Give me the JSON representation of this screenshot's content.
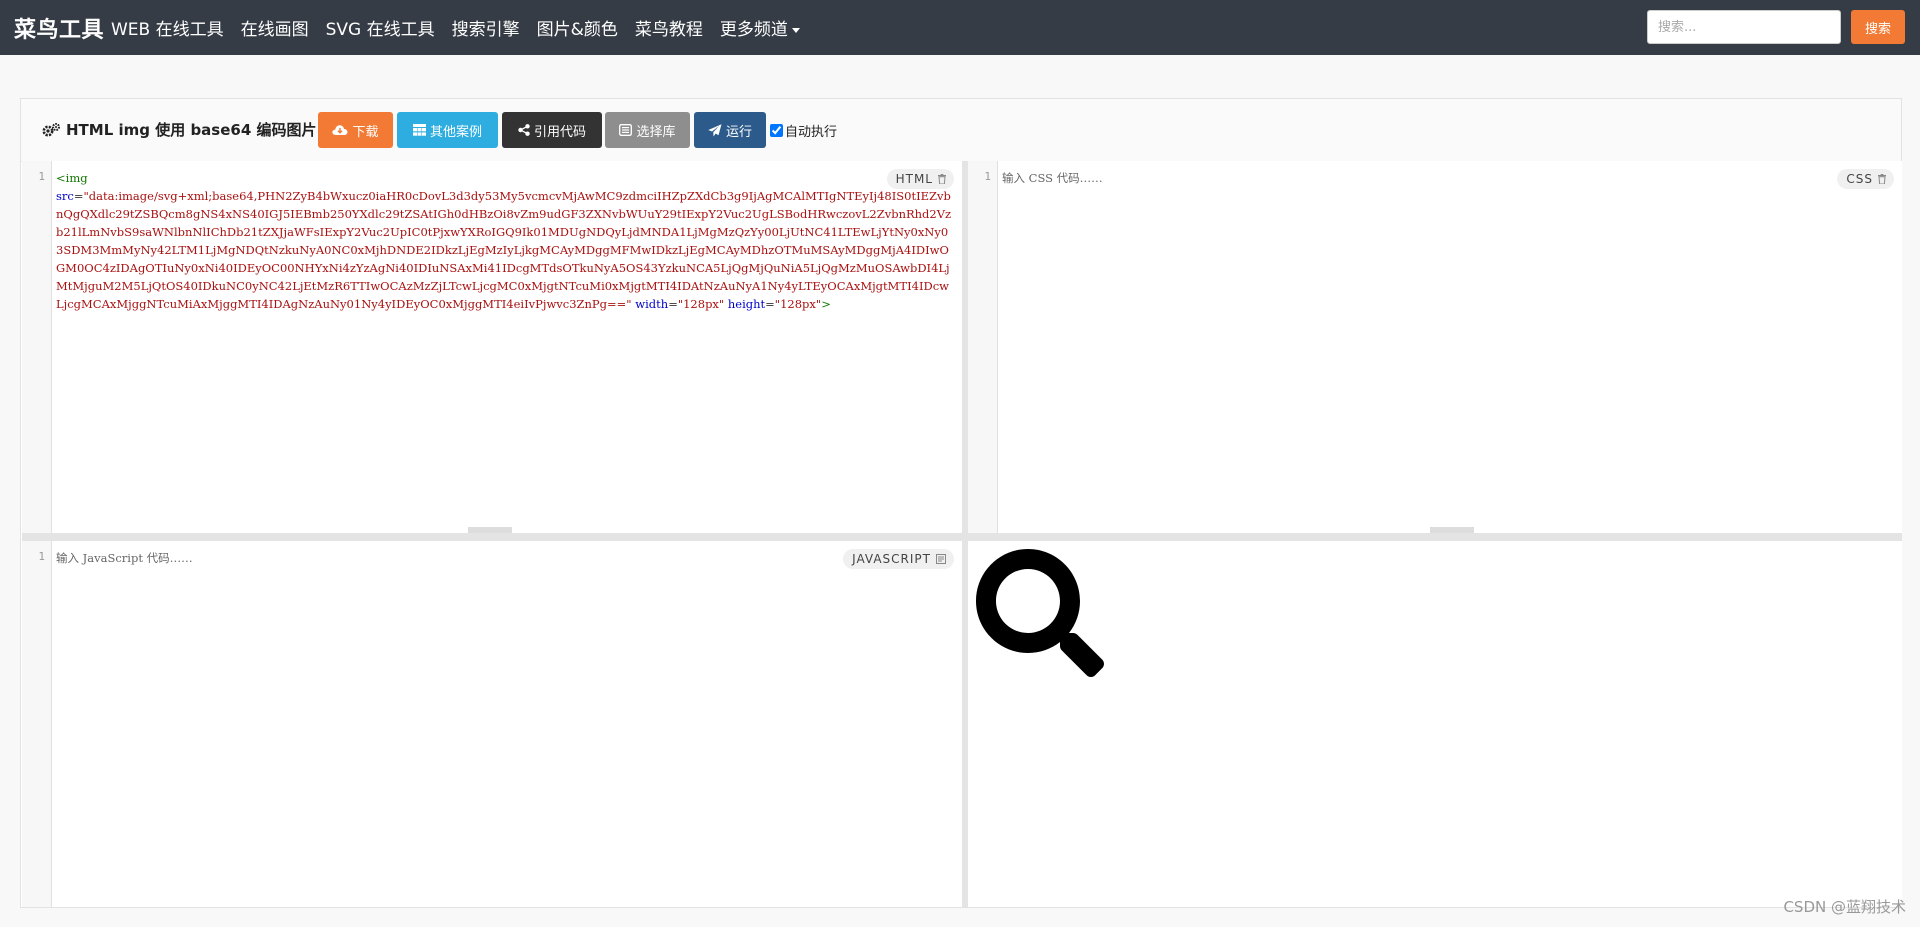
{
  "navbar": {
    "brand": "菜鸟工具",
    "items": [
      "WEB 在线工具",
      "在线画图",
      "SVG 在线工具",
      "搜索引擎",
      "图片&颜色",
      "菜鸟教程",
      "更多频道"
    ],
    "search_placeholder": "搜索...",
    "search_button": "搜索"
  },
  "toolbar": {
    "title": "HTML img 使用 base64 编码图片",
    "buttons": {
      "download": "下载",
      "examples": "其他案例",
      "cite": "引用代码",
      "library": "选择库",
      "run": "运行"
    },
    "auto_run_label": "自动执行",
    "auto_run_checked": true
  },
  "editors": {
    "html": {
      "label": "HTML",
      "line_number": "1",
      "code_tag_open": "<img",
      "code_src_attr": "src",
      "code_src_value": "\"data:image/svg+xml;base64,PHN2ZyB4bWxucz0iaHR0cDovL3d3dy53My5vcmcvMjAwMC9zdmciIHZpZXdCb3g9IjAgMCAlMTIgNTEyIj48IS0tIEZvbnQgQXdlc29tZSBQcm8gNS4xNS40IGJ5IEBmb250YXdlc29tZSAtIGh0dHBzOi8vZm9udGF3ZXNvbWUuY29tIExpY2Vuc2UgLSBodHRwczovL2ZvbnRhd2Vzb21lLmNvbS9saWNlbnNlIChDb21tZXJjaWFsIExpY2Vuc2UpIC0tPjxwYXRoIGQ9Ik01MDUgNDQyLjdMNDA1LjMgMzQzYy00LjUtNC41LTEwLjYtNy0xNy03SDM3MmMyNy42LTM1LjMgNDQtNzkuNyA0NC0xMjhDNDE2IDkzLjEgMzIyLjkgMCAyMDggMFMwIDkzLjEgMCAyMDhzOTMuMSAyMDggMjA4IDIwOGM0OC4zIDAgOTIuNy0xNi40IDEyOC00NHYxNi4zYzAgNi40IDIuNSAxMi41IDcgMTdsOTkuNyA5OS43YzkuNCA5LjQgMjQuNiA5LjQgMzMuOSAwbDI4LjMtMjguM2M5LjQtOS40IDkuNC0yNC42LjEtMzR6TTIwOCAzMzZjLTcwLjcgMC0xMjgtNTcuMi0xMjgtMTI4IDAtNzAuNyA1Ny4yLTEyOCAxMjgtMTI4IDcwLjcgMCAxMjggNTcuMiAxMjggMTI4IDAgNzAuNy01Ny4yIDEyOC0xMjggMTI4eiIvPjwvc3ZnPg==\"",
      "code_width_attr": "width",
      "code_width_value": "\"128px\"",
      "code_height_attr": "height",
      "code_height_value": "\"128px\"",
      "code_tag_close": ">"
    },
    "css": {
      "label": "CSS",
      "line_number": "1",
      "placeholder": "输入 CSS 代码……"
    },
    "js": {
      "label": "JAVASCRIPT",
      "line_number": "1",
      "placeholder": "输入 JavaScript 代码……"
    }
  },
  "preview": {
    "icon": "magnifier-icon"
  },
  "watermark": "CSDN @蓝翔技术"
}
